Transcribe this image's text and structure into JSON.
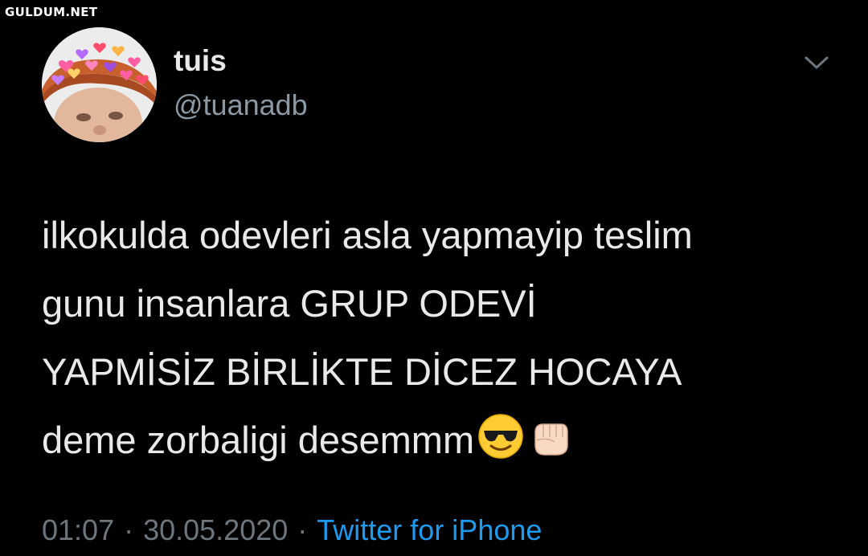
{
  "watermark": "GULDUM.NET",
  "tweet": {
    "display_name": "tuis",
    "handle": "@tuanadb",
    "text_lines": [
      "ilkokulda odevleri asla yapmayip teslim",
      "gunu insanlara GRUP ODEVİ",
      "YAPMİSİZ BİRLİKTE DİCEZ HOCAYA",
      "deme zorbaligi desemmm"
    ],
    "emojis": [
      "smiling-face-with-sunglasses-icon",
      "oncoming-fist-icon"
    ],
    "time": "01:07",
    "separator": "·",
    "date": "30.05.2020",
    "source": "Twitter for iPhone"
  },
  "colors": {
    "background": "#000000",
    "text": "#e7e9ea",
    "secondary": "#8b98a5",
    "meta": "#6e767d",
    "link": "#1d9bf0"
  }
}
